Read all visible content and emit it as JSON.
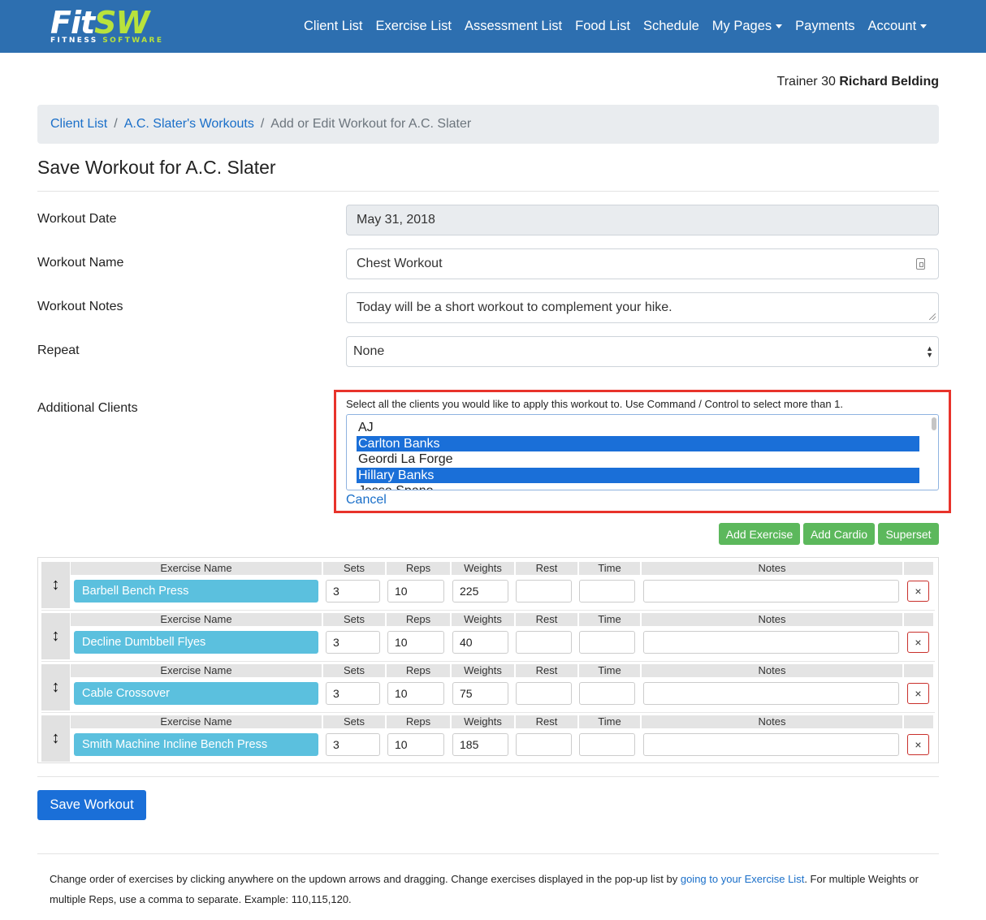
{
  "logo": {
    "fit": "Fit",
    "sw": "SW",
    "sub_white": "FITNESS",
    "sub_green": "SOFTWARE"
  },
  "nav": {
    "items": [
      {
        "label": "Client List",
        "dropdown": false
      },
      {
        "label": "Exercise List",
        "dropdown": false
      },
      {
        "label": "Assessment List",
        "dropdown": false
      },
      {
        "label": "Food List",
        "dropdown": false
      },
      {
        "label": "Schedule",
        "dropdown": false
      },
      {
        "label": "My Pages",
        "dropdown": true
      },
      {
        "label": "Payments",
        "dropdown": false
      },
      {
        "label": "Account",
        "dropdown": true
      }
    ]
  },
  "trainer": {
    "prefix": "Trainer 30",
    "name": "Richard Belding"
  },
  "breadcrumb": {
    "link1": "Client List",
    "link2": "A.C. Slater's Workouts",
    "active": "Add or Edit Workout for A.C. Slater",
    "sep": "/"
  },
  "page": {
    "title": "Save Workout for A.C. Slater"
  },
  "form": {
    "date_label": "Workout Date",
    "date_value": "May 31, 2018",
    "name_label": "Workout Name",
    "name_value": "Chest Workout",
    "notes_label": "Workout Notes",
    "notes_value": "Today will be a short workout to complement your hike.",
    "repeat_label": "Repeat",
    "repeat_value": "None",
    "clients_label": "Additional Clients",
    "clients_help": "Select all the clients you would like to apply this workout to. Use Command / Control to select more than 1.",
    "clients_options": [
      {
        "name": "AJ",
        "selected": false
      },
      {
        "name": "Carlton Banks",
        "selected": true
      },
      {
        "name": "Geordi La Forge",
        "selected": false
      },
      {
        "name": "Hillary Banks",
        "selected": true
      },
      {
        "name": "Jesse Spano",
        "selected": false
      }
    ],
    "cancel": "Cancel"
  },
  "buttons": {
    "add_exercise": "Add Exercise",
    "add_cardio": "Add Cardio",
    "superset": "Superset",
    "save": "Save Workout",
    "delete": "×"
  },
  "table_headers": {
    "name": "Exercise Name",
    "sets": "Sets",
    "reps": "Reps",
    "weights": "Weights",
    "rest": "Rest",
    "time": "Time",
    "notes": "Notes"
  },
  "exercises": [
    {
      "name": "Barbell Bench Press",
      "sets": "3",
      "reps": "10",
      "weights": "225",
      "rest": "",
      "time": "",
      "notes": ""
    },
    {
      "name": "Decline Dumbbell Flyes",
      "sets": "3",
      "reps": "10",
      "weights": "40",
      "rest": "",
      "time": "",
      "notes": ""
    },
    {
      "name": "Cable Crossover",
      "sets": "3",
      "reps": "10",
      "weights": "75",
      "rest": "",
      "time": "",
      "notes": ""
    },
    {
      "name": "Smith Machine Incline Bench Press",
      "sets": "3",
      "reps": "10",
      "weights": "185",
      "rest": "",
      "time": "",
      "notes": ""
    }
  ],
  "footer": {
    "text1": "Change order of exercises by clicking anywhere on the updown arrows and dragging. Change exercises displayed in the pop-up list by ",
    "link": "going to your Exercise List",
    "text2": ". For multiple Weights or multiple Reps, use a comma to separate. Example: 110,115,120."
  },
  "colors": {
    "nav_bg": "#2d6fb0",
    "brand_green": "#b8e23c",
    "primary": "#1a6fd8",
    "success": "#5cb85c",
    "info": "#5bc0de",
    "highlight": "#e8332b"
  }
}
